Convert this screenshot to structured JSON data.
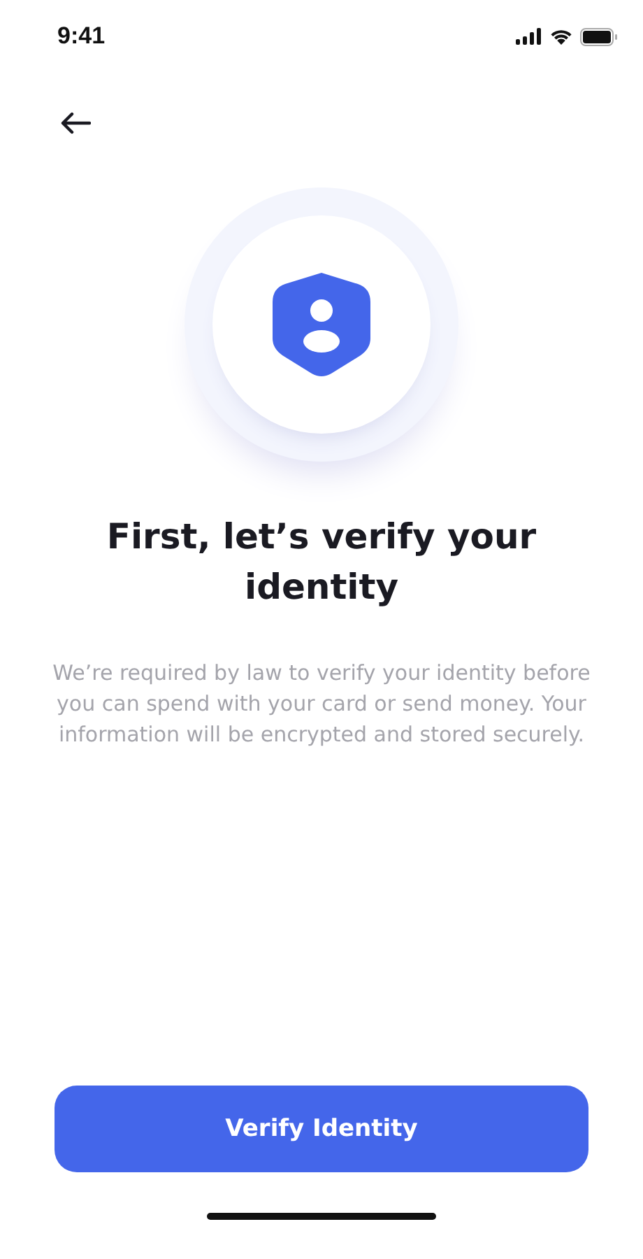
{
  "status_bar": {
    "time": "9:41"
  },
  "title": "First, let’s verify your identity",
  "description": "We’re required by law to verify your identity before you can spend with your card or send money. Your information will be encrypted and stored securely.",
  "primary_button": {
    "label": "Verify Identity"
  }
}
